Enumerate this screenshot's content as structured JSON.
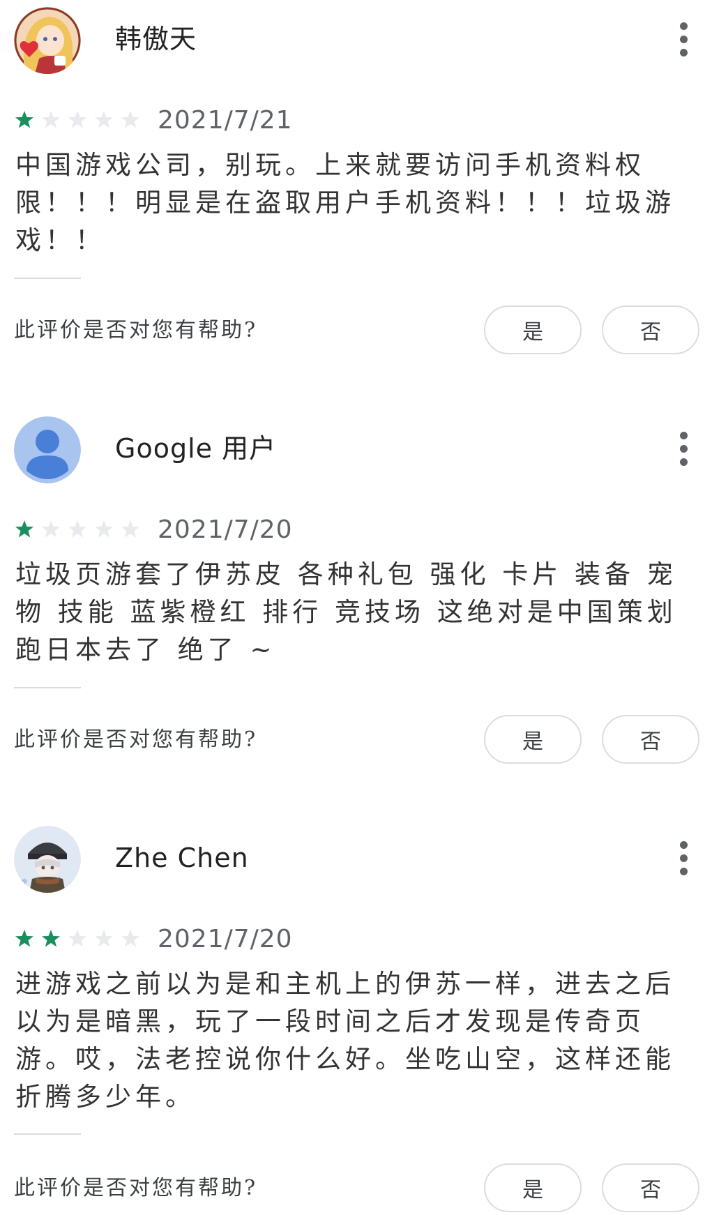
{
  "reviews": [
    {
      "user": "韩傲天",
      "avatar": "anime-girl-avatar-icon",
      "rating": 1,
      "max_rating": 5,
      "date": "2021/7/21",
      "text": "中国游戏公司，别玩。上来就要访问手机资料权限！！！明显是在盗取用户手机资料！！！垃圾游戏！！",
      "helpful_question": "此评价是否对您有帮助?",
      "yes_label": "是",
      "no_label": "否"
    },
    {
      "user": "Google 用户",
      "avatar": "default-user-avatar-icon",
      "rating": 1,
      "max_rating": 5,
      "date": "2021/7/20",
      "text": "垃圾页游套了伊苏皮 各种礼包 强化 卡片 装备 宠物 技能 蓝紫橙红 排行 竞技场 这绝对是中国策划跑日本去了 绝了 ~",
      "helpful_question": "此评价是否对您有帮助?",
      "yes_label": "是",
      "no_label": "否"
    },
    {
      "user": "Zhe Chen",
      "avatar": "anime-boy-avatar-icon",
      "rating": 2,
      "max_rating": 5,
      "date": "2021/7/20",
      "text": "进游戏之前以为是和主机上的伊苏一样，进去之后以为是暗黑，玩了一段时间之后才发现是传奇页游。哎，法老控说你什么好。坐吃山空，这样还能折腾多少年。",
      "helpful_question": "此评价是否对您有帮助?",
      "yes_label": "是",
      "no_label": "否"
    }
  ],
  "colors": {
    "star_filled": "#1a8f5c",
    "star_empty": "#e8eaed",
    "divider": "#dadce0",
    "button_border": "#dadce0"
  }
}
